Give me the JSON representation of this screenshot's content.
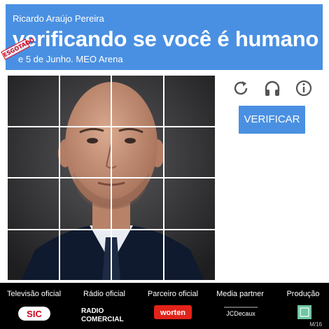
{
  "header": {
    "subtitle": "Ricardo Araújo Pereira",
    "title": "verificando se você é humano",
    "date": "e 5 de Junho. MEO Arena",
    "stamp": "ESGOTADO"
  },
  "icons": [
    "refresh-icon",
    "headphones-icon",
    "info-icon"
  ],
  "button": {
    "label": "VERIFICAR"
  },
  "grid": {
    "rows": 4,
    "cols": 4
  },
  "footer": {
    "columns": [
      {
        "label": "Televisão oficial",
        "logo": "SIC"
      },
      {
        "label": "Rádio oficial",
        "logo": "RADIO COMERCIAL"
      },
      {
        "label": "Parceiro oficial",
        "logo": "worten"
      },
      {
        "label": "Media partner",
        "logo": "JCDecaux"
      },
      {
        "label": "Produção",
        "logo": "producao-logo"
      }
    ],
    "rating": "M/16"
  },
  "colors": {
    "accent": "#4a90e2",
    "stamp": "#d0021b",
    "worten": "#e2231a",
    "green": "#6dc7a4"
  }
}
